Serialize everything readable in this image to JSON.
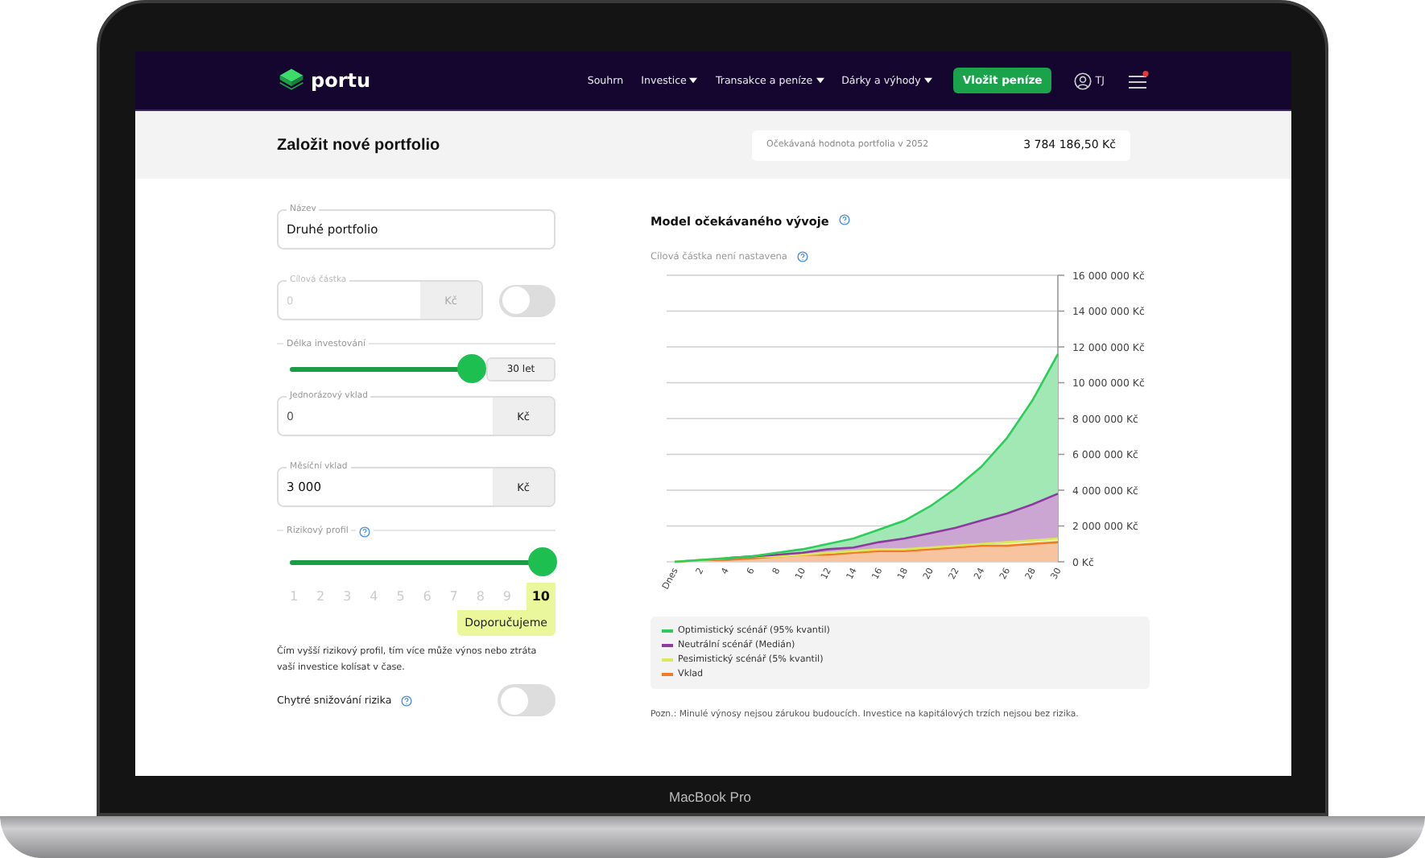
{
  "nav": {
    "logo": "portu",
    "items": [
      {
        "label": "Souhrn",
        "dropdown": false
      },
      {
        "label": "Investice",
        "dropdown": true
      },
      {
        "label": "Transakce a peníze",
        "dropdown": true
      },
      {
        "label": "Dárky a výhody",
        "dropdown": true
      }
    ],
    "cta": "Vložit peníze",
    "user": "TJ",
    "notification": true
  },
  "header": {
    "title": "Založit nové portfolio",
    "expected_label": "Očekávaná hodnota portfolia v 2052",
    "expected_value": "3 784 186,50 Kč"
  },
  "form": {
    "name": {
      "label": "Název",
      "value": "Druhé portfolio"
    },
    "target": {
      "label": "Cílová částka",
      "placeholder": "0",
      "unit": "Kč",
      "disabled": true,
      "toggle_on": false
    },
    "duration": {
      "label": "Délka investování",
      "level": 1,
      "value": "30 let"
    },
    "one_time": {
      "label": "Jednorázový vklad",
      "value": "0",
      "unit": "Kč"
    },
    "monthly": {
      "label": "Měsíční vklad",
      "value": "3 000",
      "unit": "Kč"
    },
    "risk": {
      "label": "Rizikový profil",
      "level": 1,
      "options": [
        {
          "label": "1",
          "selected": false
        },
        {
          "label": "2",
          "selected": false
        },
        {
          "label": "3",
          "selected": false
        },
        {
          "label": "4",
          "selected": false
        },
        {
          "label": "5",
          "selected": false
        },
        {
          "label": "6",
          "selected": false
        },
        {
          "label": "7",
          "selected": false
        },
        {
          "label": "8",
          "selected": false
        },
        {
          "label": "9",
          "selected": false
        },
        {
          "label": "10",
          "selected": true
        }
      ],
      "recommended": "Doporučujeme",
      "description": "Čím vyšší rizikový profil, tím více může výnos nebo ztráta vaší investice kolísat v čase."
    },
    "smart_risk": {
      "label": "Chytré snižování rizika",
      "on": false
    }
  },
  "model": {
    "title": "Model očekávaného vývoje",
    "subtitle": "Cílová částka není nastavena",
    "chart_data": {
      "type": "area",
      "categories": [
        "Dnes",
        "2",
        "4",
        "6",
        "8",
        "10",
        "12",
        "14",
        "16",
        "18",
        "20",
        "22",
        "24",
        "26",
        "28",
        "30"
      ],
      "series": [
        {
          "name": "Optimistický scénář (95% kvantil)",
          "color": "#2ecc5a",
          "values": [
            0,
            100000,
            200000,
            300000,
            500000,
            700000,
            1000000,
            1300000,
            1800000,
            2300000,
            3100000,
            4100000,
            5300000,
            6900000,
            9000000,
            11600000
          ]
        },
        {
          "name": "Neutrální scénář (Medián)",
          "color": "#8e3a9e",
          "values": [
            null,
            null,
            200000,
            300000,
            400000,
            500000,
            700000,
            800000,
            1100000,
            1300000,
            1600000,
            1900000,
            2300000,
            2700000,
            3200000,
            3800000
          ]
        },
        {
          "name": "Pesimistický scénář (5% kvantil)",
          "color": "#dbe85a",
          "values": [
            0,
            100000,
            200000,
            300000,
            300000,
            400000,
            500000,
            600000,
            700000,
            700000,
            800000,
            900000,
            1000000,
            1100000,
            1200000,
            1300000
          ]
        },
        {
          "name": "Vklad",
          "color": "#f07a2a",
          "values": [
            0,
            100000,
            100000,
            200000,
            300000,
            400000,
            400000,
            500000,
            600000,
            600000,
            700000,
            800000,
            900000,
            900000,
            1000000,
            1100000
          ]
        }
      ],
      "grid": true,
      "ylim": [
        0,
        16000000
      ],
      "yticks": [
        {
          "value": 0,
          "label": "0 Kč"
        },
        {
          "value": 2000000,
          "label": "2 000 000 Kč"
        },
        {
          "value": 4000000,
          "label": "4 000 000 Kč"
        },
        {
          "value": 6000000,
          "label": "6 000 000 Kč"
        },
        {
          "value": 8000000,
          "label": "8 000 000 Kč"
        },
        {
          "value": 10000000,
          "label": "10 000 000 Kč"
        },
        {
          "value": 12000000,
          "label": "12 000 000 Kč"
        },
        {
          "value": 14000000,
          "label": "14 000 000 Kč"
        },
        {
          "value": 16000000,
          "label": "16 000 000 Kč"
        }
      ]
    },
    "note": "Pozn.: Minulé výnosy nejsou zárukou budoucích. Investice na kapitálových trzích nejsou bez rizika."
  },
  "device": {
    "label": "MacBook Pro"
  }
}
